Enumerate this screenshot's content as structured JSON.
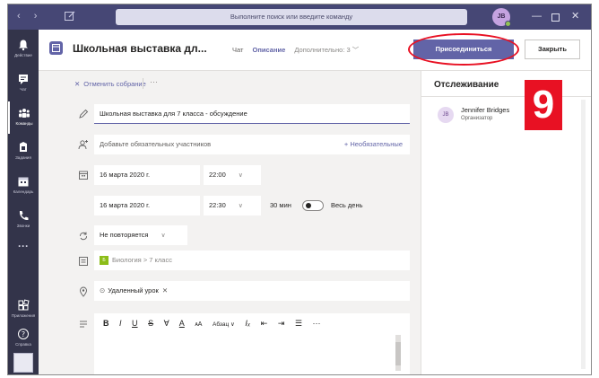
{
  "titlebar": {
    "nav_arrows": "‹ ›",
    "search_placeholder": "Выполните поиск или введите команду",
    "avatar_initials": "JB",
    "minimize": "—",
    "close": "✕"
  },
  "rail": {
    "items": [
      {
        "label": "Действие",
        "icon": "bell-icon"
      },
      {
        "label": "Чат",
        "icon": "chat-icon"
      },
      {
        "label": "Команды",
        "icon": "teams-icon",
        "active": true
      },
      {
        "label": "Задания",
        "icon": "assignments-icon"
      },
      {
        "label": "Календарь",
        "icon": "calendar-icon"
      },
      {
        "label": "Звонки",
        "icon": "phone-icon"
      }
    ],
    "more": "···",
    "apps_label": "Приложения",
    "help_label": "Справка"
  },
  "header": {
    "title": "Школьная выставка дл...",
    "tabs": {
      "chat": "Чат",
      "details": "Описание",
      "more": "Дополнительно: 3 ﹀"
    },
    "join_label": "Присоединиться",
    "close_label": "Закрыть"
  },
  "form": {
    "cancel_label": "Отменить собрание",
    "more": "···",
    "title_value": "Школьная выставка для 7 класса - обсуждение",
    "attendees_placeholder": "Добавьте обязательных участников",
    "optional_label": "+ Необязательные",
    "start_date": "16 марта 2020 г.",
    "start_time": "22:00",
    "end_date": "16 марта 2020 г.",
    "end_time": "22:30",
    "duration": "30 мин",
    "all_day_label": "Весь день",
    "repeat_value": "Не повторяется",
    "channel_tag": "Б",
    "channel_path": "Биология  >  7 класс",
    "location_value": "Удаленный урок",
    "toolbar": {
      "bold": "B",
      "italic": "I",
      "underline": "U",
      "strike": "S",
      "highlight": "∀",
      "font_color": "A",
      "font_size": "ᴀA",
      "paragraph": "Абзац ∨",
      "clear_format": "Iₓ",
      "outdent": "⇤",
      "indent": "⇥",
      "list": "☰",
      "more": "···"
    }
  },
  "tracking": {
    "title": "Отслеживание",
    "attendee_initials": "JB",
    "attendee_name": "Jennifer Bridges",
    "attendee_role": "Организатор"
  },
  "annotation": {
    "number": "9"
  },
  "colors": {
    "titlebar": "#464775",
    "rail": "#33344a",
    "accent": "#6264a7",
    "highlight": "#e81123"
  }
}
